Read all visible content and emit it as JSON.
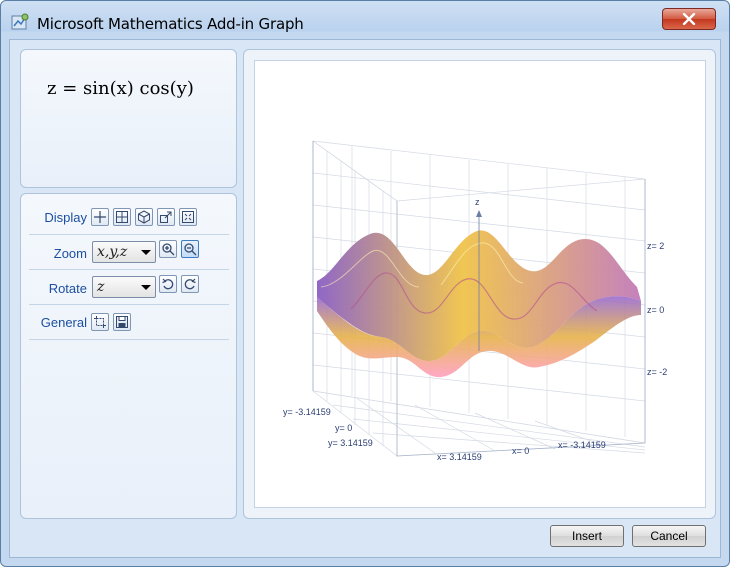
{
  "window": {
    "title": "Microsoft Mathematics Add-in Graph",
    "icon": "graph-app-icon",
    "close_icon": "close-icon"
  },
  "equation": {
    "text": "z = sin(x) cos(y)"
  },
  "controls": {
    "display": {
      "label": "Display",
      "tools": [
        "gridlines-icon",
        "grid-box-icon",
        "cube-icon",
        "resize-icon",
        "fit-to-window-icon"
      ]
    },
    "zoom": {
      "label": "Zoom",
      "selected": "x,y,z",
      "tools": [
        "zoom-in-icon",
        "zoom-out-icon"
      ]
    },
    "rotate": {
      "label": "Rotate",
      "selected": "z",
      "tools": [
        "rotate-left-icon",
        "rotate-right-icon"
      ]
    },
    "general": {
      "label": "General",
      "tools": [
        "crop-icon",
        "save-icon"
      ]
    }
  },
  "graph": {
    "z_axis_title": "z",
    "z_ticks": [
      "z= 2",
      "z= 0",
      "z= -2"
    ],
    "y_ticks": [
      "y= -3.14159",
      "y= 0",
      "y= 3.14159"
    ],
    "x_ticks": [
      "x= 3.14159",
      "x= 0",
      "x= -3.14159"
    ],
    "surface_colors": {
      "peak": "#f0c34a",
      "valley": "#ffd9e8",
      "side": "#8a5fc4"
    }
  },
  "buttons": {
    "insert": "Insert",
    "cancel": "Cancel"
  }
}
